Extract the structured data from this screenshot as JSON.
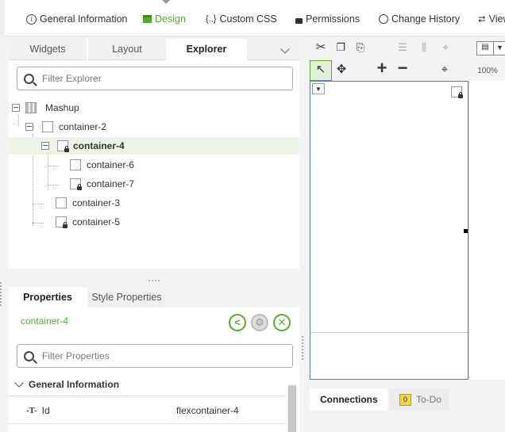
{
  "top_tabs": [
    {
      "label": "General Information",
      "icon": "info-icon"
    },
    {
      "label": "Design",
      "icon": "design-icon",
      "active": true
    },
    {
      "label": "Custom CSS",
      "icon": "braces-icon"
    },
    {
      "label": "Permissions",
      "icon": "lock-icon"
    },
    {
      "label": "Change History",
      "icon": "clock-icon"
    },
    {
      "label": "View",
      "icon": "sitemap-icon"
    }
  ],
  "explorer": {
    "tabs": [
      "Widgets",
      "Layout",
      "Explorer"
    ],
    "active_tab": "Explorer",
    "filter_placeholder": "Filter Explorer",
    "tree": [
      {
        "label": "Mashup"
      },
      {
        "label": "container-2"
      },
      {
        "label": "container-4",
        "selected": true
      },
      {
        "label": "container-6"
      },
      {
        "label": "container-7"
      },
      {
        "label": "container-3"
      },
      {
        "label": "container-5"
      }
    ]
  },
  "properties": {
    "tabs": [
      "Properties",
      "Style Properties"
    ],
    "active_tab": "Properties",
    "selected_name": "container-4",
    "filter_placeholder": "Filter Properties",
    "section_title": "General Information",
    "rows": [
      {
        "name": "Id",
        "value": "flexcontainer-4"
      }
    ]
  },
  "toolbar": {
    "zoom": "100%"
  },
  "bottom_tabs": [
    {
      "label": "Connections",
      "active": true
    },
    {
      "label": "To-Do",
      "badge": "0"
    }
  ],
  "colors": {
    "accent": "#5aa832",
    "selection_bg": "#eef5e8",
    "canvas_border": "#5e7ea6"
  }
}
